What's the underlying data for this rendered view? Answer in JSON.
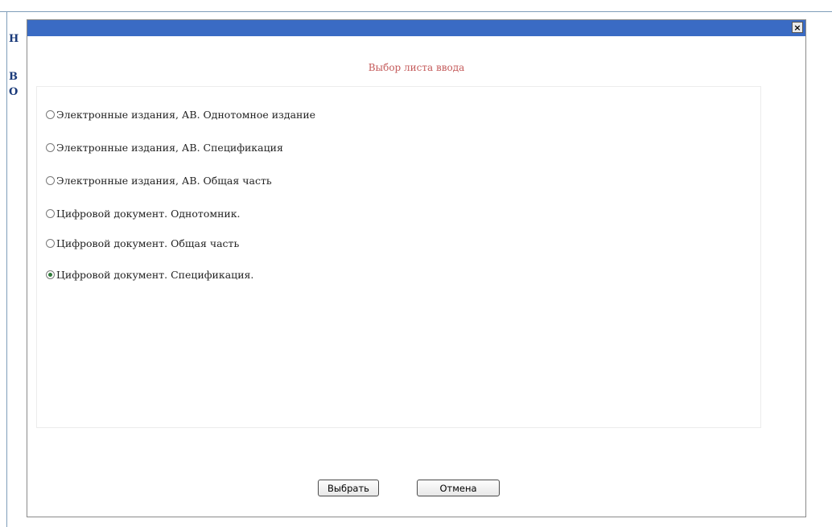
{
  "background": {
    "letters": [
      "Н",
      "В",
      "О"
    ]
  },
  "dialog": {
    "close_label": "×",
    "title": "Выбор листа ввода",
    "options": [
      {
        "label": "Электронные издания, АВ. Однотомное издание",
        "checked": false
      },
      {
        "label": "Электронные издания, АВ. Спецификация",
        "checked": false
      },
      {
        "label": "Электронные издания, АВ. Общая часть",
        "checked": false
      },
      {
        "label": "Цифровой документ. Однотомник.",
        "checked": false
      },
      {
        "label": "Цифровой документ. Общая часть",
        "checked": false
      },
      {
        "label": "Цифровой документ. Спецификация.",
        "checked": true
      }
    ],
    "select_button": "Выбрать",
    "cancel_button": "Отмена"
  },
  "colors": {
    "titlebar": "#3a6bc4",
    "title_text": "#c45a5a",
    "radio_dot": "#2f7a3a"
  }
}
